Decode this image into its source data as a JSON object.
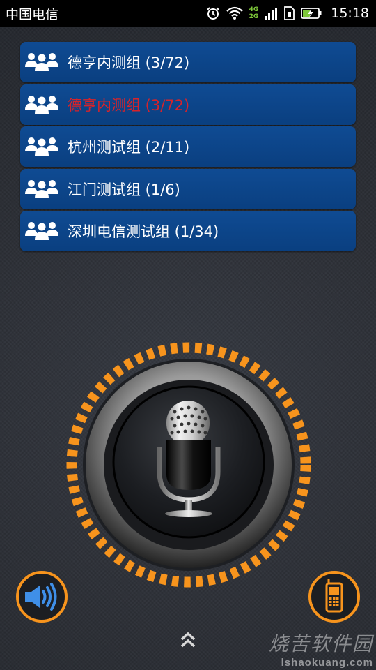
{
  "status_bar": {
    "carrier": "中国电信",
    "network_top": "4G",
    "network_bottom": "2G",
    "time": "15:18"
  },
  "groups": [
    {
      "label": "德亨内测组 (3/72)",
      "active": false
    },
    {
      "label": "德亨内测组 (3/72)",
      "active": true
    },
    {
      "label": "杭州测试组 (2/11)",
      "active": false
    },
    {
      "label": "江门测试组 (1/6)",
      "active": false
    },
    {
      "label": "深圳电信测试组 (1/34)",
      "active": false
    }
  ],
  "colors": {
    "list_bg": "#0d4589",
    "active_text": "#d7232a",
    "ring_orange": "#f7941d"
  },
  "icons": {
    "group": "group-users-icon",
    "ptt": "microphone-icon",
    "speaker": "speaker-icon",
    "phone": "mobile-phone-icon",
    "expand": "double-chevron-up-icon"
  },
  "watermark": {
    "cn": "烧苦软件园",
    "url": "lshaokuang.com"
  }
}
